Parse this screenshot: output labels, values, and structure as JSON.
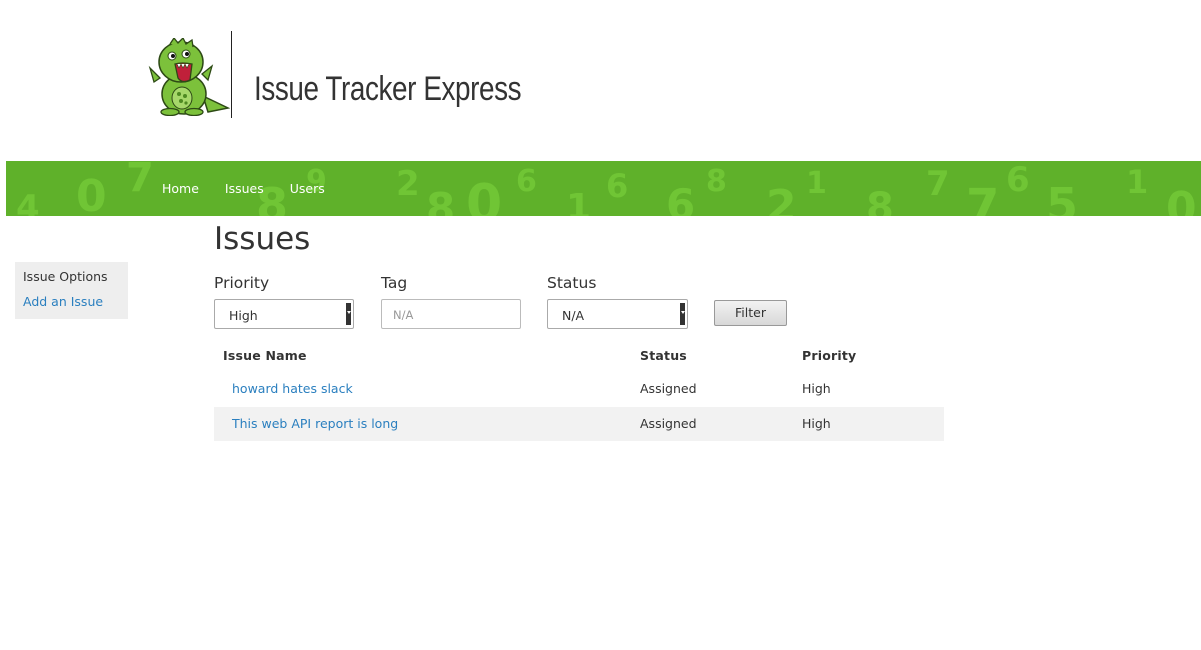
{
  "app": {
    "title": "Issue Tracker Express"
  },
  "nav": {
    "items": [
      "Home",
      "Issues",
      "Users"
    ]
  },
  "sidebar": {
    "heading": "Issue Options",
    "link": "Add an Issue"
  },
  "page": {
    "title": "Issues"
  },
  "filters": {
    "priority": {
      "label": "Priority",
      "value": "High"
    },
    "tag": {
      "label": "Tag",
      "placeholder": "N/A"
    },
    "status": {
      "label": "Status",
      "value": "N/A"
    },
    "button": "Filter"
  },
  "table": {
    "headers": [
      "Issue Name",
      "Status",
      "Priority"
    ],
    "rows": [
      {
        "name": "howard hates slack",
        "status": "Assigned",
        "priority": "High"
      },
      {
        "name": "This web API report is long",
        "status": "Assigned",
        "priority": "High"
      }
    ]
  },
  "colors": {
    "nav_green": "#5fb12a",
    "link_blue": "#2a7fbf",
    "mascot_green": "#7cc13b"
  },
  "icons": {
    "logo": "green-dinosaur-mascot-icon",
    "select_arrow": "dropdown-arrow-icon"
  }
}
